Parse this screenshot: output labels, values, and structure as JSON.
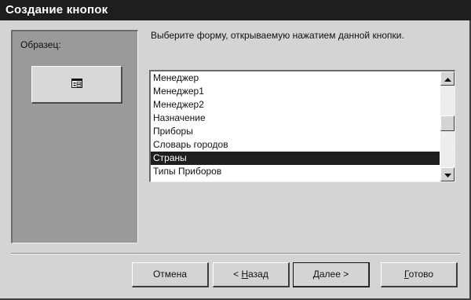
{
  "window": {
    "title": "Создание кнопок"
  },
  "preview": {
    "label": "Образец:",
    "button_icon": "form-icon"
  },
  "instruction": "Выберите форму, открываемую нажатием данной кнопки.",
  "forms_list": {
    "items": [
      {
        "label": "Менеджер"
      },
      {
        "label": "Менеджер1"
      },
      {
        "label": "Менеджер2"
      },
      {
        "label": "Назначение"
      },
      {
        "label": "Приборы"
      },
      {
        "label": "Словарь городов"
      },
      {
        "label": "Страны"
      },
      {
        "label": "Типы Приборов"
      }
    ],
    "selected": "Страны"
  },
  "buttons": {
    "cancel": {
      "label": "Отмена"
    },
    "back": {
      "prefix": "< ",
      "mnemonic": "Н",
      "rest": "азад"
    },
    "next": {
      "mnemonic": "Д",
      "rest": "алее >"
    },
    "finish": {
      "mnemonic": "Г",
      "rest": "отово"
    }
  },
  "colors": {
    "title_bg": "#1e1e1e",
    "selection_bg": "#1e1e1e",
    "dialog_bg": "#d4d4d4",
    "preview_bg": "#9a9a9a"
  }
}
